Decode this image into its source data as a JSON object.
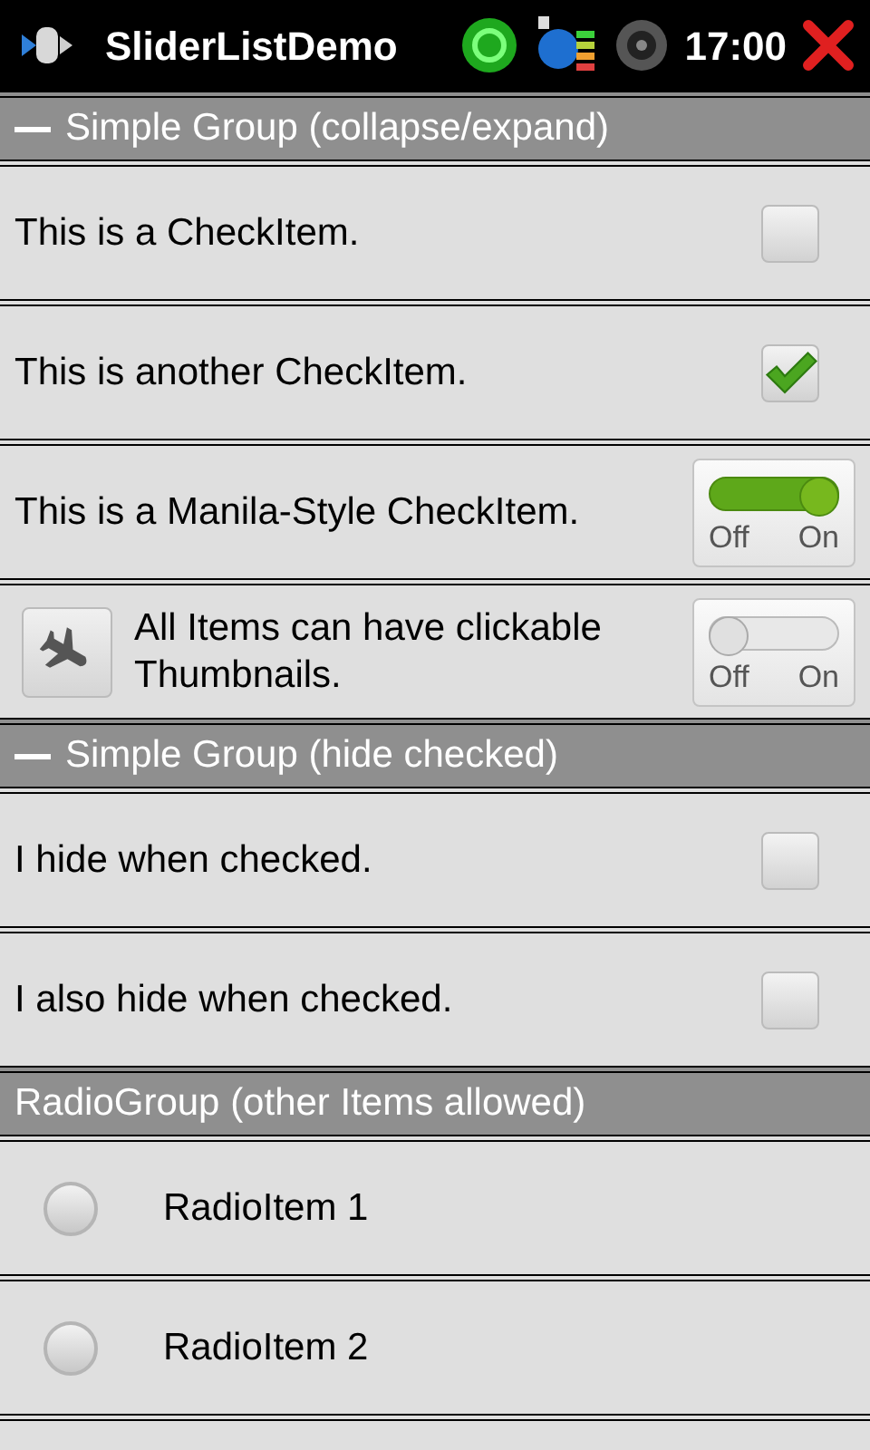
{
  "status_bar": {
    "title": "SliderListDemo",
    "time": "17:00"
  },
  "groups": [
    {
      "title": "Simple Group (collapse/expand)",
      "expanded": true,
      "items": [
        {
          "kind": "checkbox",
          "label": "This is a CheckItem.",
          "checked": false
        },
        {
          "kind": "checkbox",
          "label": "This is another CheckItem.",
          "checked": true
        },
        {
          "kind": "toggle",
          "label": "This is a Manila-Style CheckItem.",
          "on": true,
          "off_label": "Off",
          "on_label": "On"
        },
        {
          "kind": "toggle",
          "label": "All Items can have clickable Thumbnails.",
          "on": false,
          "off_label": "Off",
          "on_label": "On",
          "thumbnail": true
        }
      ]
    },
    {
      "title": "Simple Group (hide checked)",
      "expanded": true,
      "items": [
        {
          "kind": "checkbox",
          "label": "I hide when checked.",
          "checked": false
        },
        {
          "kind": "checkbox",
          "label": "I also hide when checked.",
          "checked": false
        }
      ]
    },
    {
      "title": "RadioGroup (other Items allowed)",
      "items": [
        {
          "kind": "radio",
          "label": "RadioItem 1",
          "selected": false
        },
        {
          "kind": "radio",
          "label": "RadioItem 2",
          "selected": false
        }
      ]
    }
  ]
}
